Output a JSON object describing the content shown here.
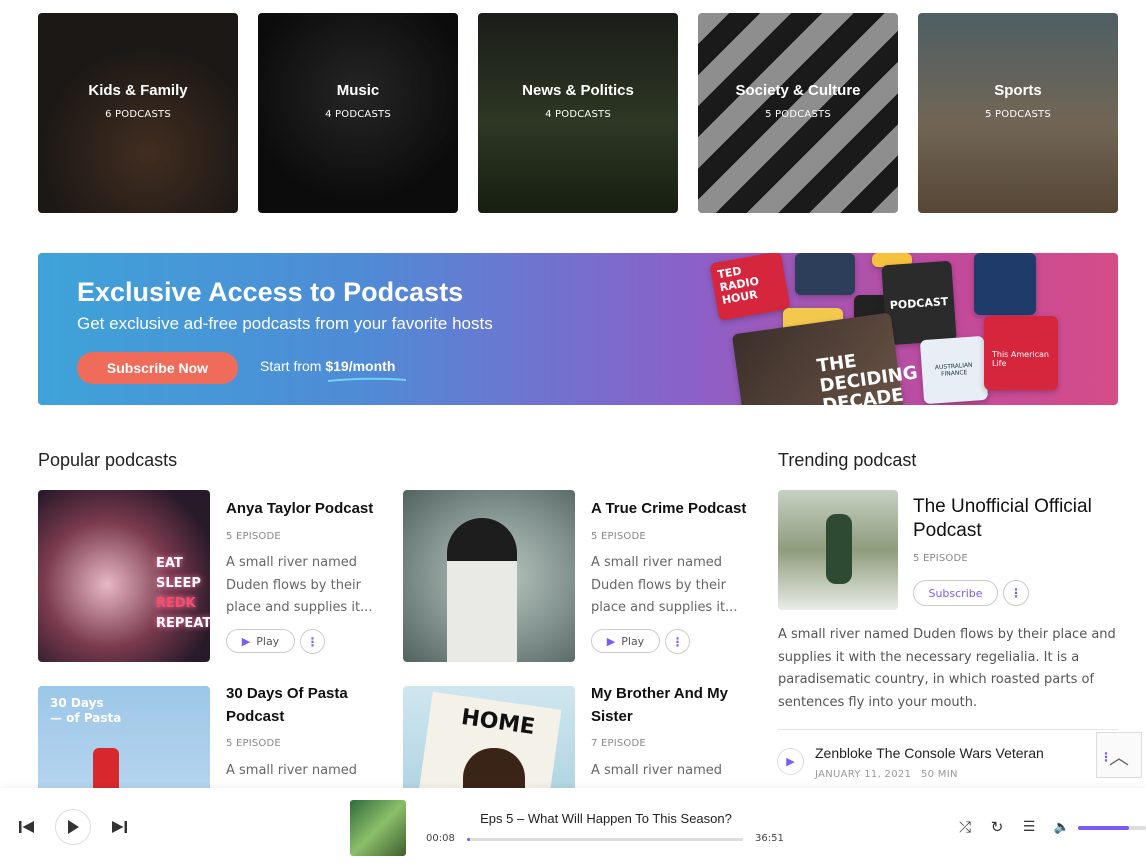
{
  "categories": [
    {
      "title": "Kids & Family",
      "count": "6 PODCASTS"
    },
    {
      "title": "Music",
      "count": "4 PODCASTS"
    },
    {
      "title": "News & Politics",
      "count": "4 PODCASTS"
    },
    {
      "title": "Society & Culture",
      "count": "5 PODCASTS"
    },
    {
      "title": "Sports",
      "count": "5 PODCASTS"
    }
  ],
  "banner": {
    "title": "Exclusive Access to Podcasts",
    "subtitle": "Get exclusive ad-free podcasts from your favorite hosts",
    "button": "Subscribe Now",
    "start_prefix": "Start from ",
    "price": "$19/month",
    "tiles": [
      "TED RADIO HOUR",
      "PODCAST",
      "THE DECIDING DECADE",
      "This American Life",
      "AUSTRALIAN FINANCE"
    ]
  },
  "popular": {
    "heading": "Popular podcasts",
    "items": [
      {
        "title": "Anya Taylor Podcast",
        "episodes": "5 EPISODE",
        "desc": "A small river named Duden flows by their place and supplies it...",
        "play": "Play",
        "image_text": [
          "EAT",
          "SLEEP",
          "REDK",
          "REPEAT"
        ]
      },
      {
        "title": "A True Crime Podcast",
        "episodes": "5 EPISODE",
        "desc": "A small river named Duden flows by their place and supplies it...",
        "play": "Play"
      },
      {
        "title": "30 Days Of Pasta Podcast",
        "episodes": "5 EPISODE",
        "desc": "A small river named",
        "image_text": [
          "30 Days",
          "— of Pasta"
        ]
      },
      {
        "title": "My Brother And My Sister",
        "episodes": "7 EPISODE",
        "desc": "A small river named",
        "image_text": [
          "HOME"
        ]
      }
    ]
  },
  "trending": {
    "heading": "Trending podcast",
    "title": "The Unofficial Official Podcast",
    "episodes": "5 EPISODE",
    "subscribe": "Subscribe",
    "desc": "A small river named Duden flows by their place and supplies it with the necessary regelialia. It is a paradisematic country, in which roasted parts of sentences fly into your mouth.",
    "episode": {
      "title": "Zenbloke The Console Wars Veteran",
      "date": "JANUARY 11, 2021",
      "duration": "50 MIN"
    }
  },
  "player": {
    "track": "Eps 5 – What Will Happen To This Season?",
    "elapsed": "00:08",
    "total": "36:51",
    "progress": 0.01,
    "volume": 0.75
  },
  "colors": {
    "accent": "#7a5af8",
    "cta": "#ef6b5a"
  }
}
